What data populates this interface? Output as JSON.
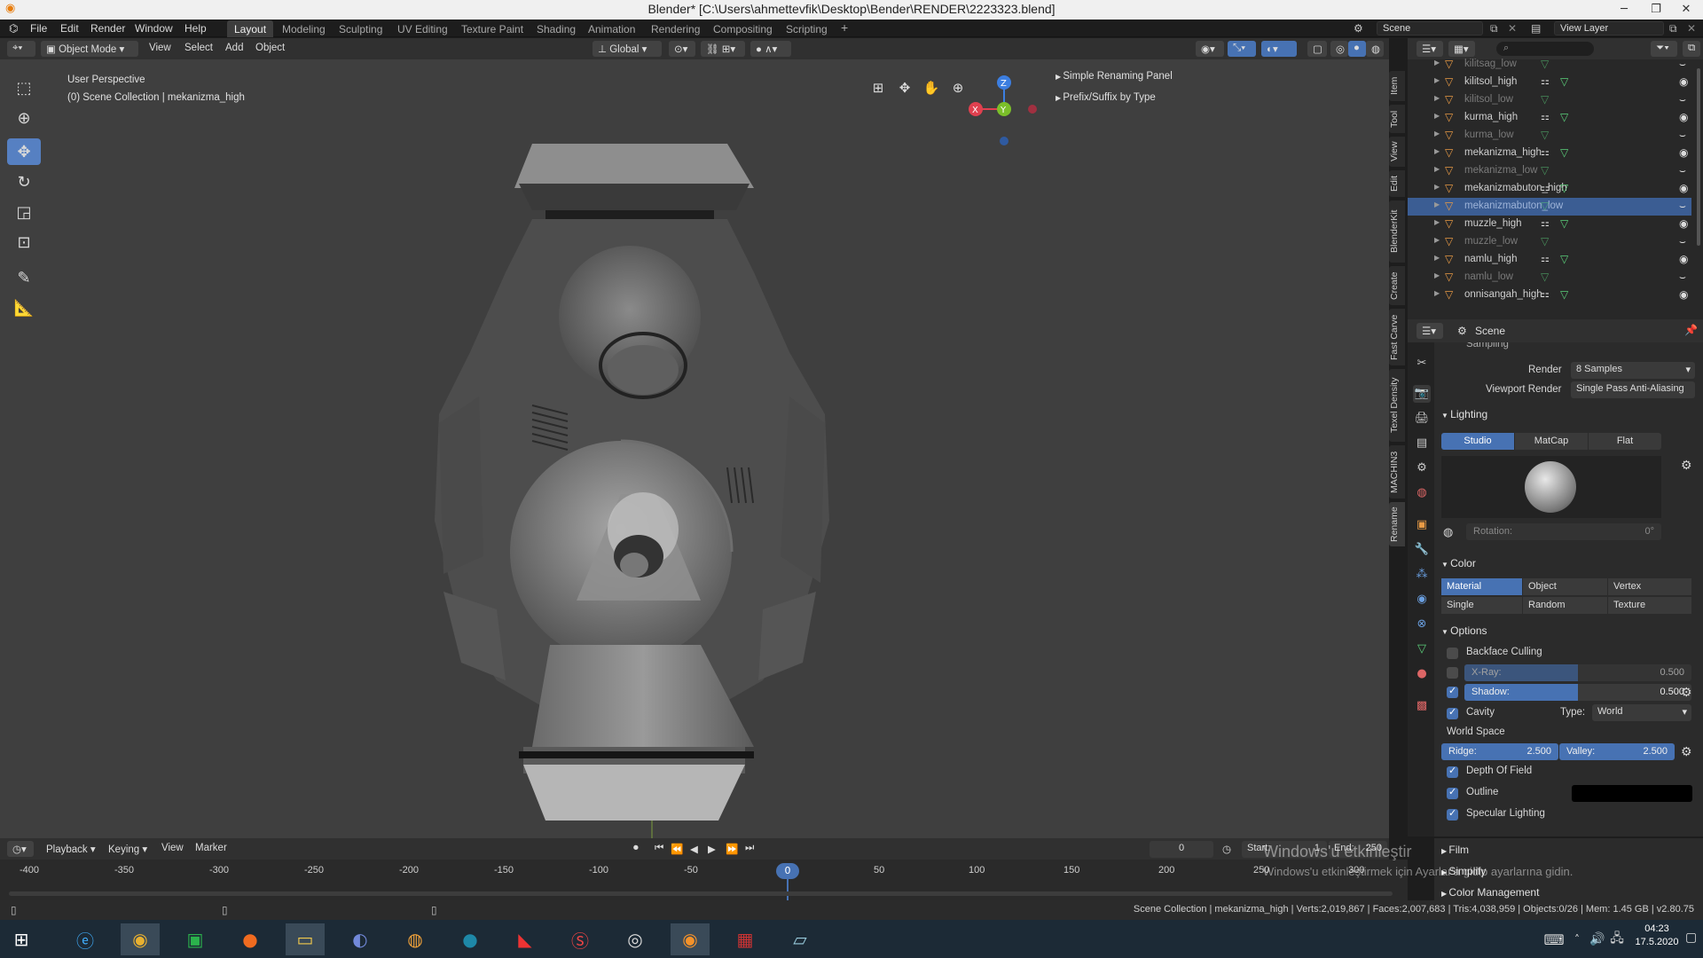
{
  "window": {
    "title": "Blender* [C:\\Users\\ahmettevfik\\Desktop\\Bender\\RENDER\\2223323.blend]"
  },
  "top_menu": [
    "File",
    "Edit",
    "Render",
    "Window",
    "Help"
  ],
  "workspace_tabs": [
    "Layout",
    "Modeling",
    "Sculpting",
    "UV Editing",
    "Texture Paint",
    "Shading",
    "Animation",
    "Rendering",
    "Compositing",
    "Scripting"
  ],
  "active_workspace": "Layout",
  "scene_name": "Scene",
  "view_layer": "View Layer",
  "viewport_header": {
    "mode": "Object Mode",
    "menus": [
      "View",
      "Select",
      "Add",
      "Object"
    ],
    "orientation": "Global"
  },
  "viewport": {
    "view_name": "User Perspective",
    "collection_info": "(0) Scene Collection | mekanizma_high",
    "panels": [
      "Simple Renaming Panel",
      "Prefix/Suffix by Type"
    ],
    "gizmo_axes": {
      "x": "X",
      "y": "Y",
      "z": "Z"
    }
  },
  "sidebar_tabs": [
    "Item",
    "Tool",
    "View",
    "Edit",
    "BlenderKit",
    "Create",
    "Fast Carve",
    "Texel Density",
    "MACHIN3",
    "Rename"
  ],
  "outliner": {
    "items": [
      {
        "name": "kilitsag_low",
        "dim": true,
        "selected": false
      },
      {
        "name": "kilitsol_high",
        "dim": false,
        "selected": false
      },
      {
        "name": "kilitsol_low",
        "dim": true,
        "selected": false
      },
      {
        "name": "kurma_high",
        "dim": false,
        "selected": false
      },
      {
        "name": "kurma_low",
        "dim": true,
        "selected": false
      },
      {
        "name": "mekanizma_high",
        "dim": false,
        "selected": false
      },
      {
        "name": "mekanizma_low",
        "dim": true,
        "selected": false
      },
      {
        "name": "mekanizmabuton_high",
        "dim": false,
        "selected": false
      },
      {
        "name": "mekanizmabuton_low",
        "dim": true,
        "selected": true
      },
      {
        "name": "muzzle_high",
        "dim": false,
        "selected": false
      },
      {
        "name": "muzzle_low",
        "dim": true,
        "selected": false
      },
      {
        "name": "namlu_high",
        "dim": false,
        "selected": false
      },
      {
        "name": "namlu_low",
        "dim": true,
        "selected": false
      },
      {
        "name": "onnisangah_high",
        "dim": false,
        "selected": false
      }
    ]
  },
  "properties": {
    "context": "Scene",
    "sampling_label": "Sampling",
    "render_label": "Render",
    "render_value": "8 Samples",
    "viewport_render_label": "Viewport Render",
    "viewport_render_value": "Single Pass Anti-Aliasing",
    "lighting_label": "Lighting",
    "lighting_modes": [
      "Studio",
      "MatCap",
      "Flat"
    ],
    "rotation_label": "Rotation:",
    "rotation_value": "0°",
    "color_label": "Color",
    "color_modes": [
      "Material",
      "Object",
      "Vertex",
      "Single",
      "Random",
      "Texture"
    ],
    "options_label": "Options",
    "backface_culling": "Backface Culling",
    "xray_label": "X-Ray:",
    "xray_value": "0.500",
    "xray_fraction": 0.5,
    "shadow_label": "Shadow:",
    "shadow_value": "0.500",
    "shadow_fraction": 0.5,
    "cavity_label": "Cavity",
    "type_label": "Type:",
    "type_value": "World",
    "world_space": "World Space",
    "ridge_label": "Ridge:",
    "ridge_value": "2.500",
    "valley_label": "Valley:",
    "valley_value": "2.500",
    "dof_label": "Depth Of Field",
    "outline_label": "Outline",
    "specular_label": "Specular Lighting",
    "film_label": "Film",
    "simplify_label": "Simplify",
    "color_mgmt_label": "Color Management"
  },
  "timeline": {
    "menus": [
      "Playback",
      "Keying",
      "View",
      "Marker"
    ],
    "current_frame": "0",
    "start_label": "Start:",
    "start_value": "1",
    "end_label": "End:",
    "end_value": "250",
    "ticks": [
      "-400",
      "-350",
      "-300",
      "-250",
      "-200",
      "-150",
      "-100",
      "-50",
      "0",
      "50",
      "100",
      "150",
      "200",
      "250",
      "300"
    ]
  },
  "watermark": {
    "line1": "Windows'u etkinleştir",
    "line2": "Windows'u etkinleştirmek için Ayarlar'a gidip ayarlarına gidin."
  },
  "status_bar": {
    "text": "Scene Collection | mekanizma_high | Verts:2,019,867 | Faces:2,007,683 | Tris:4,038,959 | Objects:0/26 | Mem: 1.45 GB | v2.80.75"
  },
  "taskbar": {
    "time": "04:23",
    "date": "17.5.2020"
  },
  "colors": {
    "accent": "#4772b3",
    "selected_row": "#3b5d93",
    "object_icon": "#e89a45",
    "mesh_icon": "#5bcf7a"
  }
}
